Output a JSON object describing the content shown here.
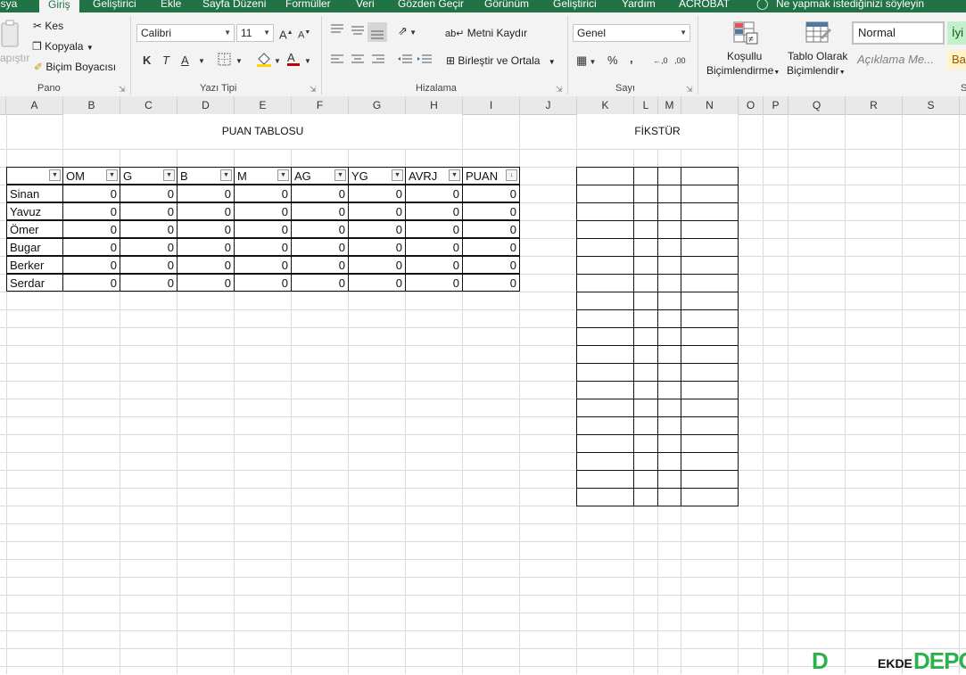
{
  "ribbon_tabs": [
    "osya",
    "Giriş",
    "Geliştirici",
    "Ekle",
    "Sayfa Düzeni",
    "Formüller",
    "Veri",
    "Gözden Geçir",
    "Görünüm",
    "Geliştirici",
    "Yardım",
    "ACROBAT"
  ],
  "tell_me": "Ne yapmak istediğinizi söyleyin",
  "clipboard": {
    "paste": "apıştır",
    "cut": "Kes",
    "copy": "Kopyala",
    "format_painter": "Biçim Boyacısı",
    "group": "Pano"
  },
  "font": {
    "name": "Calibri",
    "size": "11",
    "bold": "K",
    "italic": "T",
    "underline": "A",
    "group": "Yazı Tipi"
  },
  "alignment": {
    "wrap": "Metni Kaydır",
    "merge": "Birleştir ve Ortala",
    "group": "Hizalama"
  },
  "number": {
    "format": "Genel",
    "percent": "%",
    "comma": ",",
    "inc": "←,0",
    "dec": ",00",
    "group": "Sayı"
  },
  "styles": {
    "conditional": [
      "Koşullu",
      "Biçimlendirme"
    ],
    "as_table": [
      "Tablo Olarak",
      "Biçimlendir"
    ],
    "normal": "Normal",
    "good": "İyi",
    "explanatory": "Açıklama Me...",
    "ba": "Ba",
    "group_cut": "S"
  },
  "columns": [
    "A",
    "B",
    "C",
    "D",
    "E",
    "F",
    "G",
    "H",
    "I",
    "J",
    "K",
    "L",
    "M",
    "N",
    "O",
    "P",
    "Q",
    "R",
    "S"
  ],
  "sheet": {
    "puan_title": "PUAN TABLOSU",
    "fikstur_title": "FİKSTÜR",
    "table_headers": [
      "",
      "OM",
      "G",
      "B",
      "M",
      "AG",
      "YG",
      "AVRJ",
      "PUAN"
    ],
    "rows": [
      {
        "name": "Sinan",
        "values": [
          "0",
          "0",
          "0",
          "0",
          "0",
          "0",
          "0",
          "0"
        ]
      },
      {
        "name": "Yavuz",
        "values": [
          "0",
          "0",
          "0",
          "0",
          "0",
          "0",
          "0",
          "0"
        ]
      },
      {
        "name": "Ömer",
        "values": [
          "0",
          "0",
          "0",
          "0",
          "0",
          "0",
          "0",
          "0"
        ]
      },
      {
        "name": "Bugar",
        "values": [
          "0",
          "0",
          "0",
          "0",
          "0",
          "0",
          "0",
          "0"
        ]
      },
      {
        "name": "Berker",
        "values": [
          "0",
          "0",
          "0",
          "0",
          "0",
          "0",
          "0",
          "0"
        ]
      },
      {
        "name": "Serdar",
        "values": [
          "0",
          "0",
          "0",
          "0",
          "0",
          "0",
          "0",
          "0"
        ]
      }
    ]
  },
  "watermark": {
    "left": "D",
    "mid": "EKDE",
    "right": "DEPO"
  },
  "colors": {
    "accent": "#217346",
    "gridline": "#dadada",
    "border": "#111111"
  }
}
